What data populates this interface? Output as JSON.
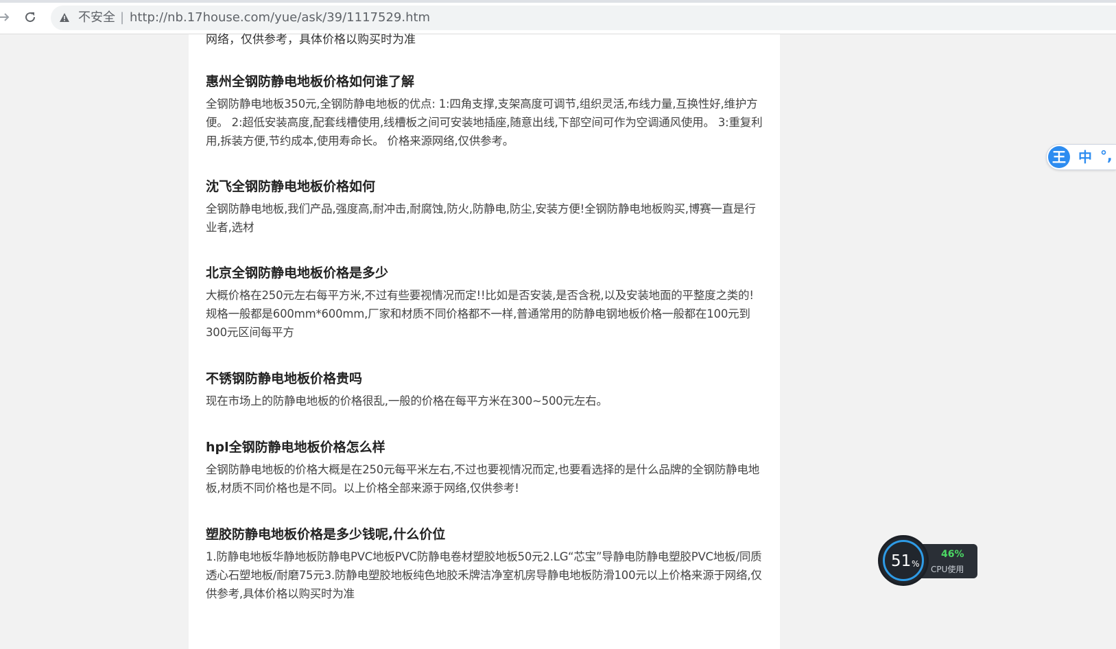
{
  "browser": {
    "security_label": "不安全",
    "separator": "|",
    "url": "http://nb.17house.com/yue/ask/39/1117529.htm"
  },
  "article": {
    "clipped_top_line": "网络，仅供参考，具体价格以购买时为准",
    "items": [
      {
        "title": "惠州全钢防静电地板价格如何谁了解",
        "body": "全钢防静电地板350元,全钢防静电地板的优点: 1:四角支撑,支架高度可调节,组织灵活,布线力量,互换性好,维护方便。 2:超低安装高度,配套线槽使用,线槽板之间可安装地插座,随意出线,下部空间可作为空调通风使用。 3:重复利用,拆装方便,节约成本,使用寿命长。 价格来源网络,仅供参考。"
      },
      {
        "title": "沈飞全钢防静电地板价格如何",
        "body": "全钢防静电地板,我们产品,强度高,耐冲击,耐腐蚀,防火,防静电,防尘,安装方便!全钢防静电地板购买,博赛一直是行业者,选材"
      },
      {
        "title": "北京全钢防静电地板价格是多少",
        "body": "大概价格在250元左右每平方米,不过有些要视情况而定!!比如是否安装,是否含税,以及安装地面的平整度之类的!规格一般都是600mm*600mm,厂家和材质不同价格都不一样,普通常用的防静电钢地板价格一般都在100元到300元区间每平方"
      },
      {
        "title": "不锈钢防静电地板价格贵吗",
        "body": "现在市场上的防静电地板的价格很乱,一般的价格在每平方米在300~500元左右。"
      },
      {
        "title": "hpl全钢防静电地板价格怎么样",
        "body": "全钢防静电地板的价格大概是在250元每平米左右,不过也要视情况而定,也要看选择的是什么品牌的全钢防静电地板,材质不同价格也是不同。以上价格全部来源于网络,仅供参考!"
      },
      {
        "title": "塑胶防静电地板价格是多少钱呢,什么价位",
        "body": "1.防静电地板华静地板防静电PVC地板PVC防静电卷材塑胶地板50元2.LG“芯宝”导静电防静电塑胶PVC地板/同质透心石塑地板/耐磨75元3.防静电塑胶地板纯色地胶禾牌洁净室机房导静电地板防滑100元以上价格来源于网络,仅供参考,具体价格以购买时为准"
      }
    ]
  },
  "ime_toolbar": {
    "logo": "王",
    "lang": "中",
    "punct": "°,"
  },
  "system_monitor": {
    "memory_value": "51",
    "memory_unit": "%",
    "cpu_value": "46%",
    "cpu_label": "CPU使用"
  }
}
